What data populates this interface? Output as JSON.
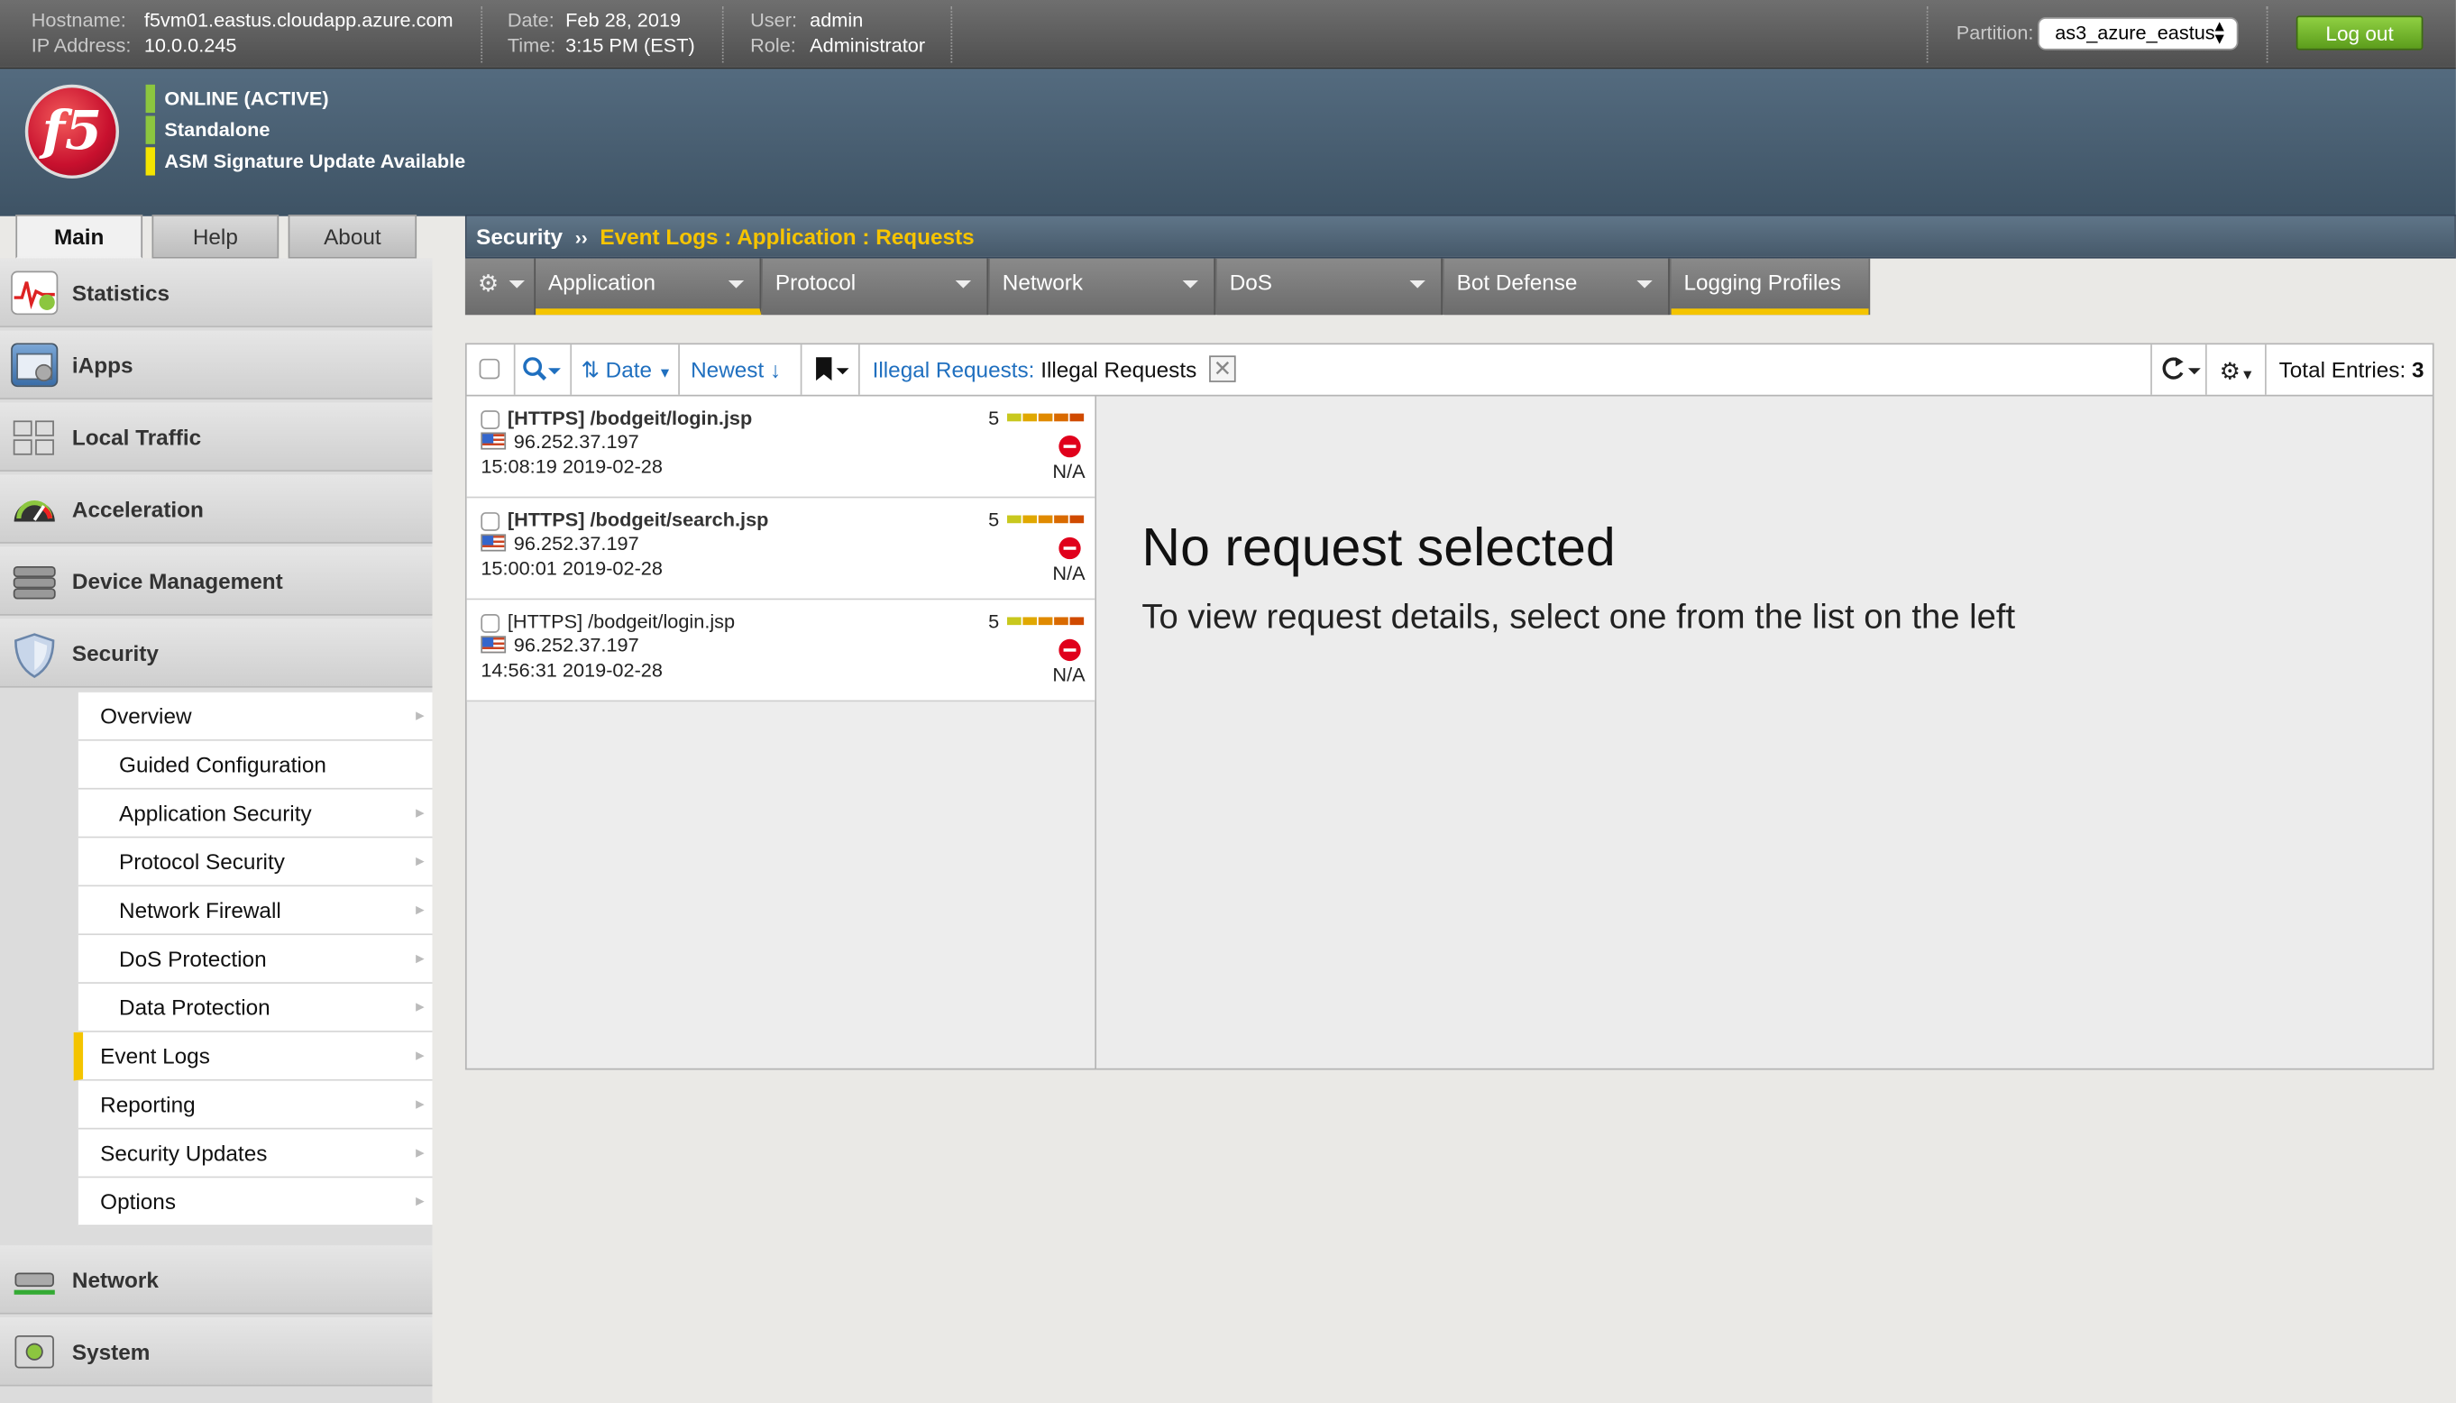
{
  "topbar": {
    "hostname_label": "Hostname:",
    "hostname": "f5vm01.eastus.cloudapp.azure.com",
    "ip_label": "IP Address:",
    "ip": "10.0.0.245",
    "date_label": "Date:",
    "date": "Feb 28, 2019",
    "time_label": "Time:",
    "time": "3:15 PM (EST)",
    "user_label": "User:",
    "user": "admin",
    "role_label": "Role:",
    "role": "Administrator",
    "partition_label": "Partition:",
    "partition_value": "as3_azure_eastus",
    "logout_label": "Log out"
  },
  "header": {
    "logo_text": "f5",
    "status": [
      {
        "text": "ONLINE (ACTIVE)",
        "color": "#8cc63f"
      },
      {
        "text": "Standalone",
        "color": "#8cc63f"
      },
      {
        "text": "ASM Signature Update Available",
        "color": "#f4e400"
      }
    ]
  },
  "main_tabs": [
    "Main",
    "Help",
    "About"
  ],
  "sidebar": {
    "items": [
      {
        "label": "Statistics",
        "icon": "statistics-icon"
      },
      {
        "label": "iApps",
        "icon": "iapps-icon"
      },
      {
        "label": "Local Traffic",
        "icon": "local-traffic-icon"
      },
      {
        "label": "Acceleration",
        "icon": "acceleration-icon"
      },
      {
        "label": "Device Management",
        "icon": "device-management-icon"
      },
      {
        "label": "Security",
        "icon": "security-shield-icon"
      },
      {
        "label": "Network",
        "icon": "network-icon"
      },
      {
        "label": "System",
        "icon": "system-icon"
      }
    ],
    "security_sub": [
      {
        "label": "Overview"
      },
      {
        "label": "Guided Configuration"
      },
      {
        "label": "Application Security"
      },
      {
        "label": "Protocol Security"
      },
      {
        "label": "Network Firewall"
      },
      {
        "label": "DoS Protection"
      },
      {
        "label": "Data Protection"
      },
      {
        "label": "Event Logs"
      },
      {
        "label": "Reporting"
      },
      {
        "label": "Security Updates"
      },
      {
        "label": "Options"
      }
    ]
  },
  "breadcrumb": {
    "root": "Security",
    "sep": "››",
    "path": "Event Logs : Application : Requests"
  },
  "subtabs": [
    "Application",
    "Protocol",
    "Network",
    "DoS",
    "Bot Defense",
    "Logging Profiles"
  ],
  "toolbar": {
    "sort_label": "Date",
    "order_label": "Newest",
    "filter_key": "Illegal Requests:",
    "filter_value": "Illegal Requests",
    "total_label": "Total Entries:",
    "total_value": "3"
  },
  "requests": [
    {
      "path": "[HTTPS] /bodgeit/login.jsp",
      "ip": "96.252.37.197",
      "timestamp": "15:08:19 2019-02-28",
      "score": "5",
      "status": "N/A",
      "bold": true
    },
    {
      "path": "[HTTPS] /bodgeit/search.jsp",
      "ip": "96.252.37.197",
      "timestamp": "15:00:01 2019-02-28",
      "score": "5",
      "status": "N/A",
      "bold": true
    },
    {
      "path": "[HTTPS] /bodgeit/login.jsp",
      "ip": "96.252.37.197",
      "timestamp": "14:56:31 2019-02-28",
      "score": "5",
      "status": "N/A",
      "bold": false
    }
  ],
  "detail": {
    "title": "No request selected",
    "subtitle": "To view request details, select one from the list on the left"
  },
  "colors": {
    "accent_yellow": "#f4c400",
    "score_bars": [
      "#c8c81e",
      "#e0a800",
      "#e08a00",
      "#d96a00",
      "#d04a00"
    ]
  }
}
